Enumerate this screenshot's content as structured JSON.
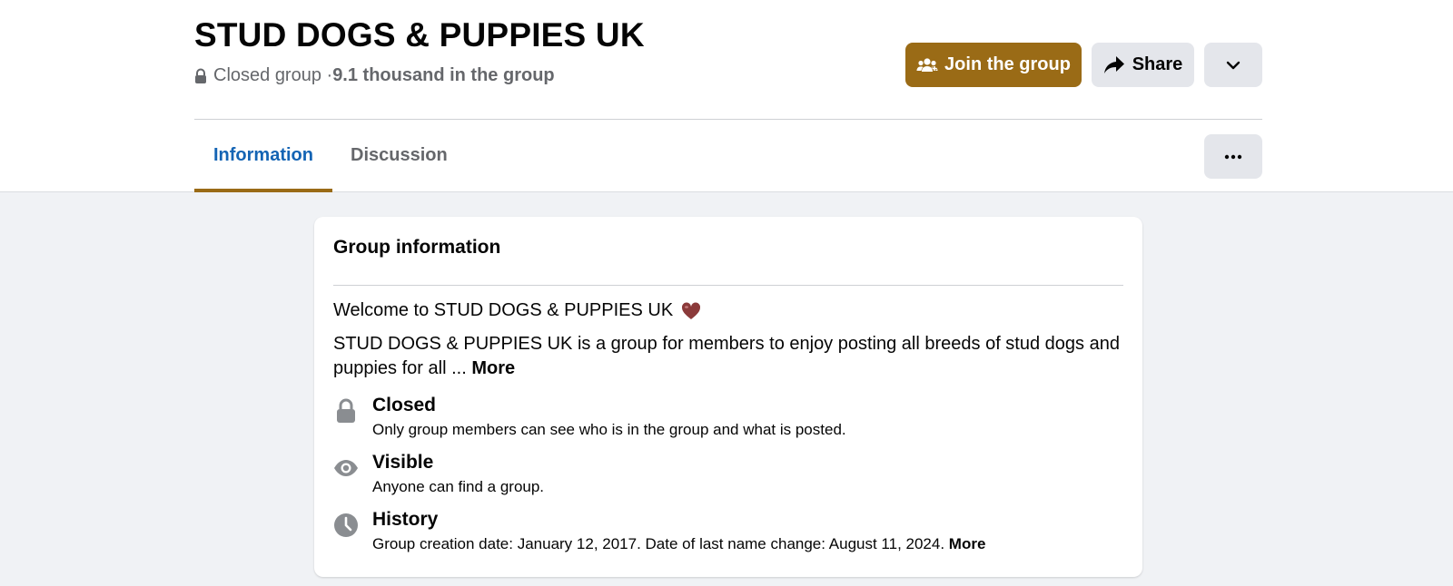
{
  "group": {
    "title": "STUD DOGS & PUPPIES UK",
    "privacy": "Closed group · ",
    "members": "9.1 thousand in the group"
  },
  "actions": {
    "join_label": "Join the group",
    "share_label": "Share"
  },
  "tabs": [
    {
      "label": "Information",
      "active": true
    },
    {
      "label": "Discussion",
      "active": false
    }
  ],
  "info_card": {
    "title": "Group information",
    "welcome": "Welcome to STUD DOGS & PUPPIES UK",
    "description": "STUD DOGS & PUPPIES UK is a group for members to enjoy posting all breeds of stud dogs and puppies for all ... ",
    "description_more": "More",
    "items": [
      {
        "icon": "lock-icon",
        "title": "Closed",
        "text": "Only group members can see who is in the group and what is posted."
      },
      {
        "icon": "eye-icon",
        "title": "Visible",
        "text": "Anyone can find a group."
      },
      {
        "icon": "clock-icon",
        "title": "History",
        "text": "Group creation date: January 12, 2017. Date of last name change: August 11, 2024. ",
        "more": "More"
      }
    ]
  },
  "colors": {
    "accent": "#9a6b16",
    "link": "#1464b4",
    "background": "#f0f2f5",
    "button_gray": "#e4e6eb",
    "heart": "#8b3a3a"
  }
}
